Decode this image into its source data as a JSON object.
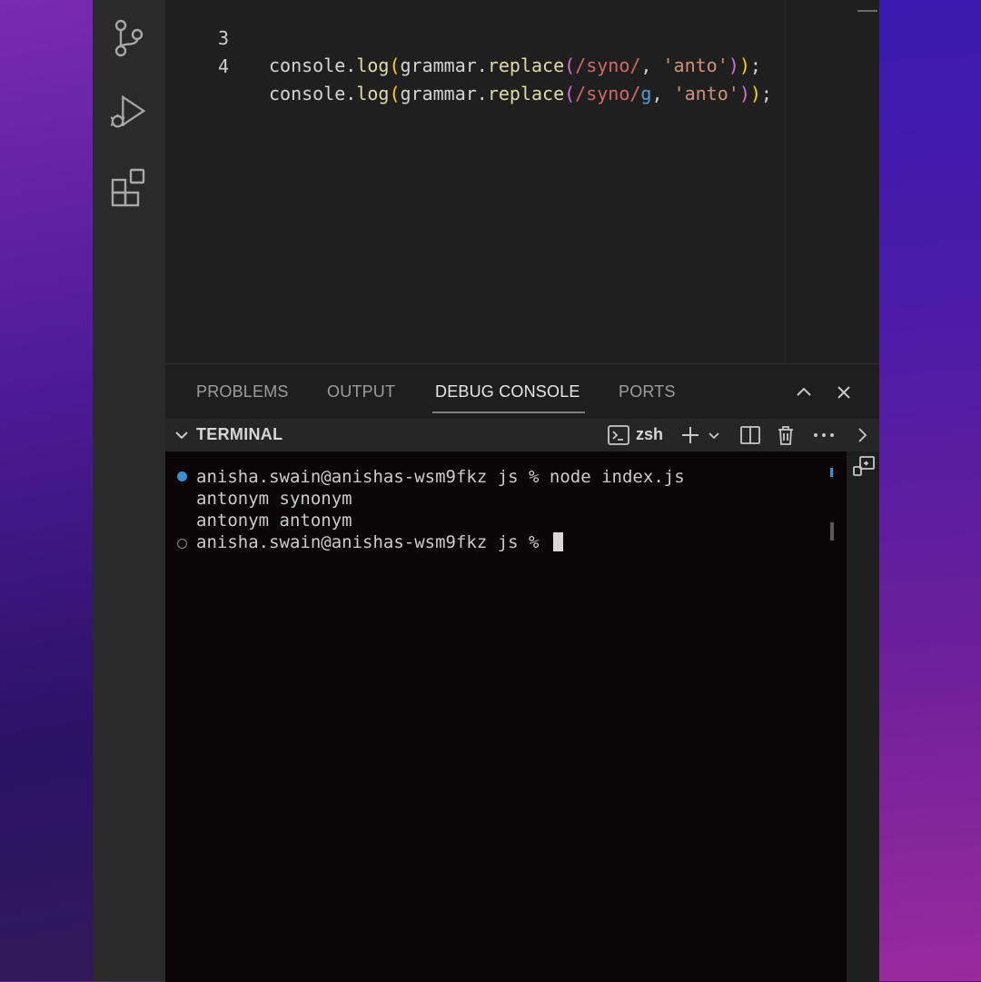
{
  "editor": {
    "lines": [
      {
        "num": "3",
        "prefix": "console.",
        "fn": "log",
        "open1": "(",
        "obj": "grammar.",
        "method": "replace",
        "open2": "(",
        "regex": "/syno/",
        "flag": "",
        "sep": ", ",
        "str": "'anto'",
        "close2": ")",
        "close1": ")",
        "end": ";"
      },
      {
        "num": "4",
        "prefix": "console.",
        "fn": "log",
        "open1": "(",
        "obj": "grammar.",
        "method": "replace",
        "open2": "(",
        "regex": "/syno/",
        "flag": "g",
        "sep": ", ",
        "str": "'anto'",
        "close2": ")",
        "close1": ")",
        "end": ";"
      }
    ]
  },
  "panel": {
    "tabs": [
      {
        "label": "PROBLEMS"
      },
      {
        "label": "OUTPUT"
      },
      {
        "label": "DEBUG CONSOLE"
      },
      {
        "label": "PORTS"
      }
    ],
    "active_tab": "DEBUG CONSOLE"
  },
  "terminal": {
    "title": "TERMINAL",
    "shell": "zsh",
    "lines": [
      "anisha.swain@anishas-wsm9fkz js % node index.js",
      "antonym synonym",
      "antonym antonym",
      "anisha.swain@anishas-wsm9fkz js % "
    ]
  },
  "icons": {
    "activity": [
      "source-control-icon",
      "run-debug-icon",
      "extensions-icon"
    ],
    "panel_actions": [
      "chevron-up-icon",
      "close-icon"
    ],
    "terminal_actions": [
      "terminal-icon",
      "plus-icon",
      "chevron-down-icon",
      "split-icon",
      "trash-icon",
      "more-icon",
      "chevron-right-icon",
      "terminal-move-icon"
    ]
  },
  "colors": {
    "accent_blue": "#3a8fd1",
    "editor_bg": "#1f1f1f",
    "terminal_bg": "#0a0506"
  }
}
